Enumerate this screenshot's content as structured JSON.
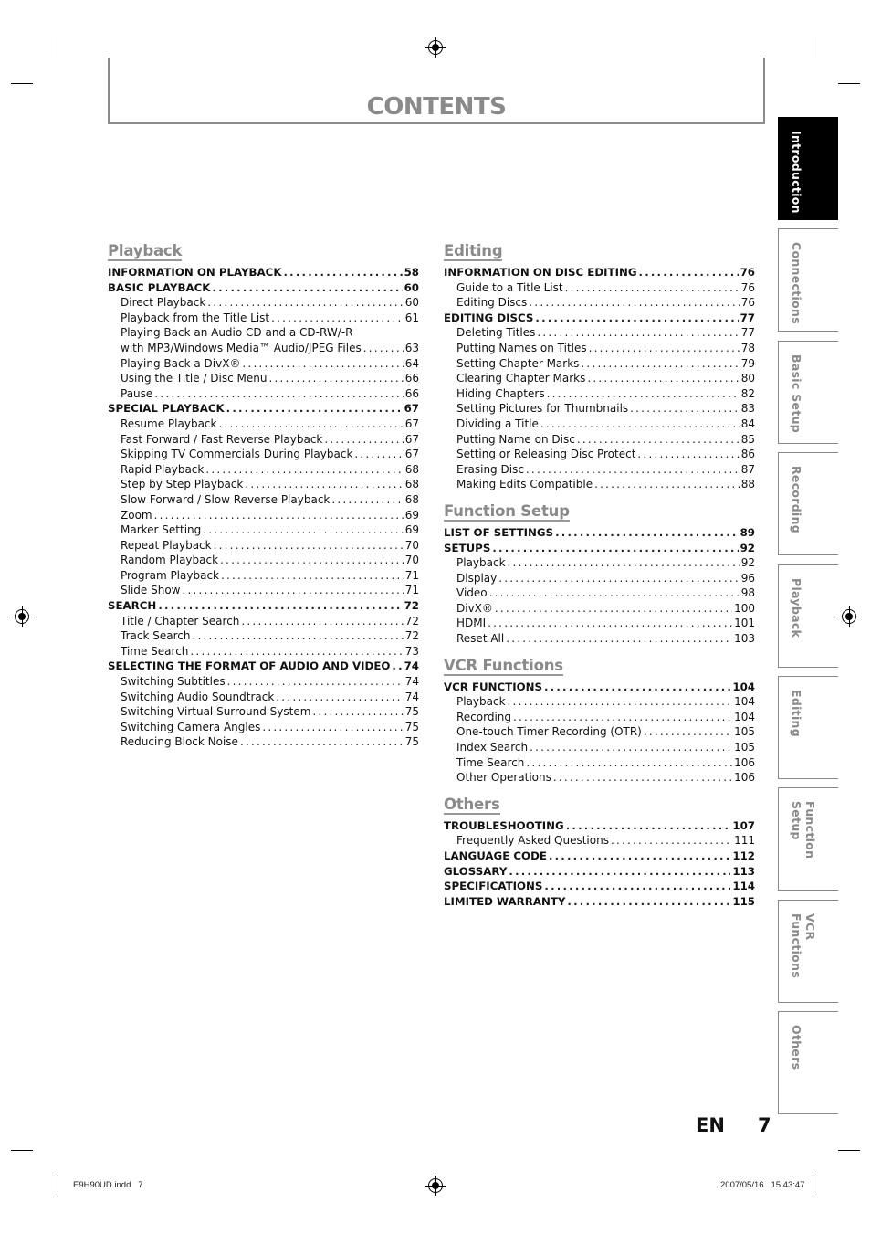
{
  "page": {
    "title": "CONTENTS",
    "language_label": "EN",
    "page_number": "7",
    "slug_file": "E9H90UD.indd   7",
    "slug_datetime": "2007/05/16   15:43:47"
  },
  "side_tabs": [
    {
      "label": "Introduction",
      "active": true
    },
    {
      "label": "Connections",
      "active": false
    },
    {
      "label": "Basic Setup",
      "active": false
    },
    {
      "label": "Recording",
      "active": false
    },
    {
      "label": "Playback",
      "active": false
    },
    {
      "label": "Editing",
      "active": false
    },
    {
      "label": "Function Setup",
      "active": false
    },
    {
      "label": "VCR Functions",
      "active": false
    },
    {
      "label": "Others",
      "active": false
    }
  ],
  "left_column": [
    {
      "title": "Playback",
      "entries": [
        {
          "label": "INFORMATION ON PLAYBACK",
          "page": "58",
          "level": 1
        },
        {
          "label": "BASIC PLAYBACK",
          "page": "60",
          "level": 1
        },
        {
          "label": "Direct Playback",
          "page": "60",
          "level": 2
        },
        {
          "label": "Playback from the Title List",
          "page": "61",
          "level": 2
        },
        {
          "label": "Playing Back an Audio CD and a CD-RW/-R",
          "page": "",
          "level": 2
        },
        {
          "label": "with MP3/Windows Media™ Audio/JPEG Files",
          "page": "63",
          "level": 2
        },
        {
          "label": "Playing Back a DivX®",
          "page": "64",
          "level": 2
        },
        {
          "label": "Using the Title / Disc Menu",
          "page": "66",
          "level": 2
        },
        {
          "label": "Pause",
          "page": "66",
          "level": 2
        },
        {
          "label": "SPECIAL PLAYBACK",
          "page": "67",
          "level": 1
        },
        {
          "label": "Resume Playback",
          "page": "67",
          "level": 2
        },
        {
          "label": "Fast Forward / Fast Reverse Playback",
          "page": "67",
          "level": 2
        },
        {
          "label": "Skipping TV Commercials During Playback",
          "page": "67",
          "level": 2
        },
        {
          "label": "Rapid Playback",
          "page": "68",
          "level": 2
        },
        {
          "label": "Step by Step Playback",
          "page": "68",
          "level": 2
        },
        {
          "label": "Slow Forward / Slow Reverse Playback",
          "page": "68",
          "level": 2
        },
        {
          "label": "Zoom",
          "page": "69",
          "level": 2
        },
        {
          "label": "Marker Setting",
          "page": "69",
          "level": 2
        },
        {
          "label": "Repeat Playback",
          "page": "70",
          "level": 2
        },
        {
          "label": "Random Playback",
          "page": "70",
          "level": 2
        },
        {
          "label": "Program Playback",
          "page": "71",
          "level": 2
        },
        {
          "label": "Slide Show",
          "page": "71",
          "level": 2
        },
        {
          "label": "SEARCH",
          "page": "72",
          "level": 1
        },
        {
          "label": "Title / Chapter Search",
          "page": "72",
          "level": 2
        },
        {
          "label": "Track Search",
          "page": "72",
          "level": 2
        },
        {
          "label": "Time Search",
          "page": "73",
          "level": 2
        },
        {
          "label": "SELECTING THE FORMAT OF AUDIO AND VIDEO",
          "page": "74",
          "level": 1
        },
        {
          "label": "Switching Subtitles",
          "page": "74",
          "level": 2
        },
        {
          "label": "Switching Audio Soundtrack",
          "page": "74",
          "level": 2
        },
        {
          "label": "Switching Virtual Surround System",
          "page": "75",
          "level": 2
        },
        {
          "label": "Switching Camera Angles",
          "page": "75",
          "level": 2
        },
        {
          "label": "Reducing Block Noise",
          "page": "75",
          "level": 2
        }
      ]
    }
  ],
  "right_column": [
    {
      "title": "Editing",
      "entries": [
        {
          "label": "INFORMATION ON DISC EDITING",
          "page": "76",
          "level": 1
        },
        {
          "label": "Guide to a Title List",
          "page": "76",
          "level": 2
        },
        {
          "label": "Editing Discs",
          "page": "76",
          "level": 2
        },
        {
          "label": "EDITING DISCS",
          "page": "77",
          "level": 1
        },
        {
          "label": "Deleting Titles",
          "page": "77",
          "level": 2
        },
        {
          "label": "Putting Names on Titles",
          "page": "78",
          "level": 2
        },
        {
          "label": "Setting Chapter Marks",
          "page": "79",
          "level": 2
        },
        {
          "label": "Clearing Chapter Marks",
          "page": "80",
          "level": 2
        },
        {
          "label": "Hiding Chapters",
          "page": "82",
          "level": 2
        },
        {
          "label": "Setting Pictures for Thumbnails",
          "page": "83",
          "level": 2
        },
        {
          "label": "Dividing a Title",
          "page": "84",
          "level": 2
        },
        {
          "label": "Putting Name on Disc",
          "page": "85",
          "level": 2
        },
        {
          "label": "Setting or Releasing Disc Protect",
          "page": "86",
          "level": 2
        },
        {
          "label": "Erasing Disc",
          "page": "87",
          "level": 2
        },
        {
          "label": "Making Edits Compatible",
          "page": "88",
          "level": 2
        }
      ]
    },
    {
      "title": "Function Setup",
      "entries": [
        {
          "label": "LIST OF SETTINGS",
          "page": "89",
          "level": 1
        },
        {
          "label": "SETUPS",
          "page": "92",
          "level": 1
        },
        {
          "label": "Playback",
          "page": "92",
          "level": 2
        },
        {
          "label": "Display",
          "page": "96",
          "level": 2
        },
        {
          "label": "Video",
          "page": "98",
          "level": 2
        },
        {
          "label": "DivX®",
          "page": "100",
          "level": 2
        },
        {
          "label": "HDMI",
          "page": "101",
          "level": 2
        },
        {
          "label": "Reset All",
          "page": "103",
          "level": 2
        }
      ]
    },
    {
      "title": "VCR Functions",
      "entries": [
        {
          "label": "VCR FUNCTIONS",
          "page": "104",
          "level": 1
        },
        {
          "label": "Playback",
          "page": "104",
          "level": 2
        },
        {
          "label": "Recording",
          "page": "104",
          "level": 2
        },
        {
          "label": "One-touch Timer Recording (OTR)",
          "page": "105",
          "level": 2
        },
        {
          "label": "Index Search",
          "page": "105",
          "level": 2
        },
        {
          "label": "Time Search",
          "page": "106",
          "level": 2
        },
        {
          "label": "Other Operations",
          "page": "106",
          "level": 2
        }
      ]
    },
    {
      "title": "Others",
      "entries": [
        {
          "label": "TROUBLESHOOTING",
          "page": "107",
          "level": 1
        },
        {
          "label": "Frequently Asked Questions",
          "page": "111",
          "level": 2
        },
        {
          "label": "LANGUAGE CODE",
          "page": "112",
          "level": 1
        },
        {
          "label": "GLOSSARY",
          "page": "113",
          "level": 1
        },
        {
          "label": "SPECIFICATIONS",
          "page": "114",
          "level": 1
        },
        {
          "label": "LIMITED WARRANTY",
          "page": "115",
          "level": 1
        }
      ]
    }
  ]
}
